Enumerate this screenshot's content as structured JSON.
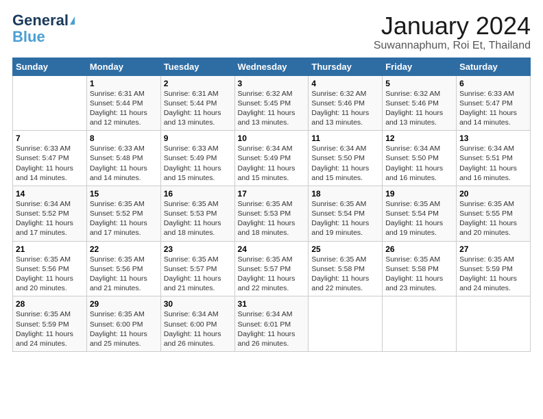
{
  "logo": {
    "line1": "General",
    "line2": "Blue"
  },
  "title": "January 2024",
  "subtitle": "Suwannaphum, Roi Et, Thailand",
  "days": [
    "Sunday",
    "Monday",
    "Tuesday",
    "Wednesday",
    "Thursday",
    "Friday",
    "Saturday"
  ],
  "weeks": [
    [
      {
        "date": "",
        "content": ""
      },
      {
        "date": "1",
        "content": "Sunrise: 6:31 AM\nSunset: 5:44 PM\nDaylight: 11 hours\nand 12 minutes."
      },
      {
        "date": "2",
        "content": "Sunrise: 6:31 AM\nSunset: 5:44 PM\nDaylight: 11 hours\nand 13 minutes."
      },
      {
        "date": "3",
        "content": "Sunrise: 6:32 AM\nSunset: 5:45 PM\nDaylight: 11 hours\nand 13 minutes."
      },
      {
        "date": "4",
        "content": "Sunrise: 6:32 AM\nSunset: 5:46 PM\nDaylight: 11 hours\nand 13 minutes."
      },
      {
        "date": "5",
        "content": "Sunrise: 6:32 AM\nSunset: 5:46 PM\nDaylight: 11 hours\nand 13 minutes."
      },
      {
        "date": "6",
        "content": "Sunrise: 6:33 AM\nSunset: 5:47 PM\nDaylight: 11 hours\nand 14 minutes."
      }
    ],
    [
      {
        "date": "7",
        "content": "Sunrise: 6:33 AM\nSunset: 5:47 PM\nDaylight: 11 hours\nand 14 minutes."
      },
      {
        "date": "8",
        "content": "Sunrise: 6:33 AM\nSunset: 5:48 PM\nDaylight: 11 hours\nand 14 minutes."
      },
      {
        "date": "9",
        "content": "Sunrise: 6:33 AM\nSunset: 5:49 PM\nDaylight: 11 hours\nand 15 minutes."
      },
      {
        "date": "10",
        "content": "Sunrise: 6:34 AM\nSunset: 5:49 PM\nDaylight: 11 hours\nand 15 minutes."
      },
      {
        "date": "11",
        "content": "Sunrise: 6:34 AM\nSunset: 5:50 PM\nDaylight: 11 hours\nand 15 minutes."
      },
      {
        "date": "12",
        "content": "Sunrise: 6:34 AM\nSunset: 5:50 PM\nDaylight: 11 hours\nand 16 minutes."
      },
      {
        "date": "13",
        "content": "Sunrise: 6:34 AM\nSunset: 5:51 PM\nDaylight: 11 hours\nand 16 minutes."
      }
    ],
    [
      {
        "date": "14",
        "content": "Sunrise: 6:34 AM\nSunset: 5:52 PM\nDaylight: 11 hours\nand 17 minutes."
      },
      {
        "date": "15",
        "content": "Sunrise: 6:35 AM\nSunset: 5:52 PM\nDaylight: 11 hours\nand 17 minutes."
      },
      {
        "date": "16",
        "content": "Sunrise: 6:35 AM\nSunset: 5:53 PM\nDaylight: 11 hours\nand 18 minutes."
      },
      {
        "date": "17",
        "content": "Sunrise: 6:35 AM\nSunset: 5:53 PM\nDaylight: 11 hours\nand 18 minutes."
      },
      {
        "date": "18",
        "content": "Sunrise: 6:35 AM\nSunset: 5:54 PM\nDaylight: 11 hours\nand 19 minutes."
      },
      {
        "date": "19",
        "content": "Sunrise: 6:35 AM\nSunset: 5:54 PM\nDaylight: 11 hours\nand 19 minutes."
      },
      {
        "date": "20",
        "content": "Sunrise: 6:35 AM\nSunset: 5:55 PM\nDaylight: 11 hours\nand 20 minutes."
      }
    ],
    [
      {
        "date": "21",
        "content": "Sunrise: 6:35 AM\nSunset: 5:56 PM\nDaylight: 11 hours\nand 20 minutes."
      },
      {
        "date": "22",
        "content": "Sunrise: 6:35 AM\nSunset: 5:56 PM\nDaylight: 11 hours\nand 21 minutes."
      },
      {
        "date": "23",
        "content": "Sunrise: 6:35 AM\nSunset: 5:57 PM\nDaylight: 11 hours\nand 21 minutes."
      },
      {
        "date": "24",
        "content": "Sunrise: 6:35 AM\nSunset: 5:57 PM\nDaylight: 11 hours\nand 22 minutes."
      },
      {
        "date": "25",
        "content": "Sunrise: 6:35 AM\nSunset: 5:58 PM\nDaylight: 11 hours\nand 22 minutes."
      },
      {
        "date": "26",
        "content": "Sunrise: 6:35 AM\nSunset: 5:58 PM\nDaylight: 11 hours\nand 23 minutes."
      },
      {
        "date": "27",
        "content": "Sunrise: 6:35 AM\nSunset: 5:59 PM\nDaylight: 11 hours\nand 24 minutes."
      }
    ],
    [
      {
        "date": "28",
        "content": "Sunrise: 6:35 AM\nSunset: 5:59 PM\nDaylight: 11 hours\nand 24 minutes."
      },
      {
        "date": "29",
        "content": "Sunrise: 6:35 AM\nSunset: 6:00 PM\nDaylight: 11 hours\nand 25 minutes."
      },
      {
        "date": "30",
        "content": "Sunrise: 6:34 AM\nSunset: 6:00 PM\nDaylight: 11 hours\nand 26 minutes."
      },
      {
        "date": "31",
        "content": "Sunrise: 6:34 AM\nSunset: 6:01 PM\nDaylight: 11 hours\nand 26 minutes."
      },
      {
        "date": "",
        "content": ""
      },
      {
        "date": "",
        "content": ""
      },
      {
        "date": "",
        "content": ""
      }
    ]
  ]
}
